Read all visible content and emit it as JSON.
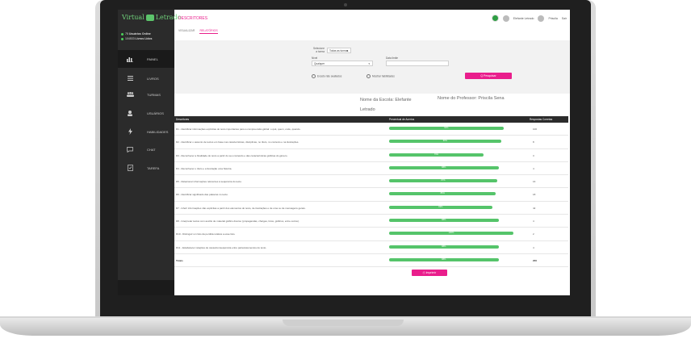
{
  "app": {
    "logo_text_left": "Virtual",
    "logo_text_right": "Letrado",
    "stats": [
      {
        "count": "75",
        "label": "Usuários Online"
      },
      {
        "count": "104533",
        "label": "Livros Lidos"
      }
    ]
  },
  "sidebar": {
    "items": [
      {
        "label": "PAINEL",
        "icon": "bar-chart-icon"
      },
      {
        "label": "LIVROS",
        "icon": "menu-icon"
      },
      {
        "label": "TURMAS",
        "icon": "group-icon"
      },
      {
        "label": "USUÁRIOS",
        "icon": "user-icon"
      },
      {
        "label": "HABILIDADES",
        "icon": "bolt-icon"
      },
      {
        "label": "CHAT",
        "icon": "chat-icon"
      },
      {
        "label": "TAREFA",
        "icon": "task-icon"
      }
    ]
  },
  "header": {
    "breadcrumb": "DESCRITORES",
    "user_name": "Elefante Letrado",
    "user2": "Priscila",
    "logout": "Sair"
  },
  "tabs": [
    "VISUALIZAR",
    "RELATÓRIOS"
  ],
  "filter": {
    "subject_label": "Selecione a turma",
    "subject_value": "Todas as turmas",
    "level_label": "Nível",
    "level_value": "Qualquer",
    "date_label": "Data limite",
    "radio1": "Exceto não avaliados",
    "radio2": "Mostrar habilidades",
    "search_button": "Q Pesquisar"
  },
  "school": "Nome da Escola: Elefante Letrado",
  "professor": "Nome do Professor: Priscila Sena",
  "table": {
    "headers": [
      "Descritores",
      "Percentual de Acertos",
      "Respostas Corretas"
    ],
    "rows": [
      {
        "desc": "D1 - Identificar informações explícitas do texto importantes para a compreensão global: o quê, quem, onde, quando.",
        "pct": 92,
        "resp": "100"
      },
      {
        "desc": "D2 - Identificar o assunto de textos em base nas características, disciplinas, no título, no contexto e na ilustrações.",
        "pct": 90,
        "resp": "8"
      },
      {
        "desc": "D3 - Reconhecer a finalidade do texto a partir do seu conteúdo e das características gráficas do gênero.",
        "pct": 76,
        "resp": "3"
      },
      {
        "desc": "D4 - Reconhecer o título e a ilustração uma história.",
        "pct": 88,
        "resp": "4"
      },
      {
        "desc": "D5 - Relacionar informações referentes à sequência do texto.",
        "pct": 87,
        "resp": "16"
      },
      {
        "desc": "D6 - Identificar significado das palavras no texto.",
        "pct": 86,
        "resp": "18"
      },
      {
        "desc": "D7 - Inferir informações não explícitas a partir dos elementos do texto, de ilustrações e de uma ou de mensagens gerais.",
        "pct": 83,
        "resp": "42"
      },
      {
        "desc": "D8 - Interpretar textos com auxílio de material gráfico diverso (propagandas, charges, fotos, gráficos, entre outros).",
        "pct": 88,
        "resp": "4"
      },
      {
        "desc": "D10 - Distinguir um fato da perdida relativa a esse fato.",
        "pct": 100,
        "resp": "2"
      },
      {
        "desc": "D11 - Estabelecer relações de causa/consequência entre partes/elementos do texto.",
        "pct": 88,
        "resp": "4"
      }
    ],
    "total": {
      "desc": "Totais",
      "pct": 88,
      "resp": "200"
    }
  },
  "print_button": "Imprimir",
  "colors": {
    "accent": "#e91e8c",
    "bar": "#55c46a",
    "sidebar": "#2b2b2b"
  }
}
